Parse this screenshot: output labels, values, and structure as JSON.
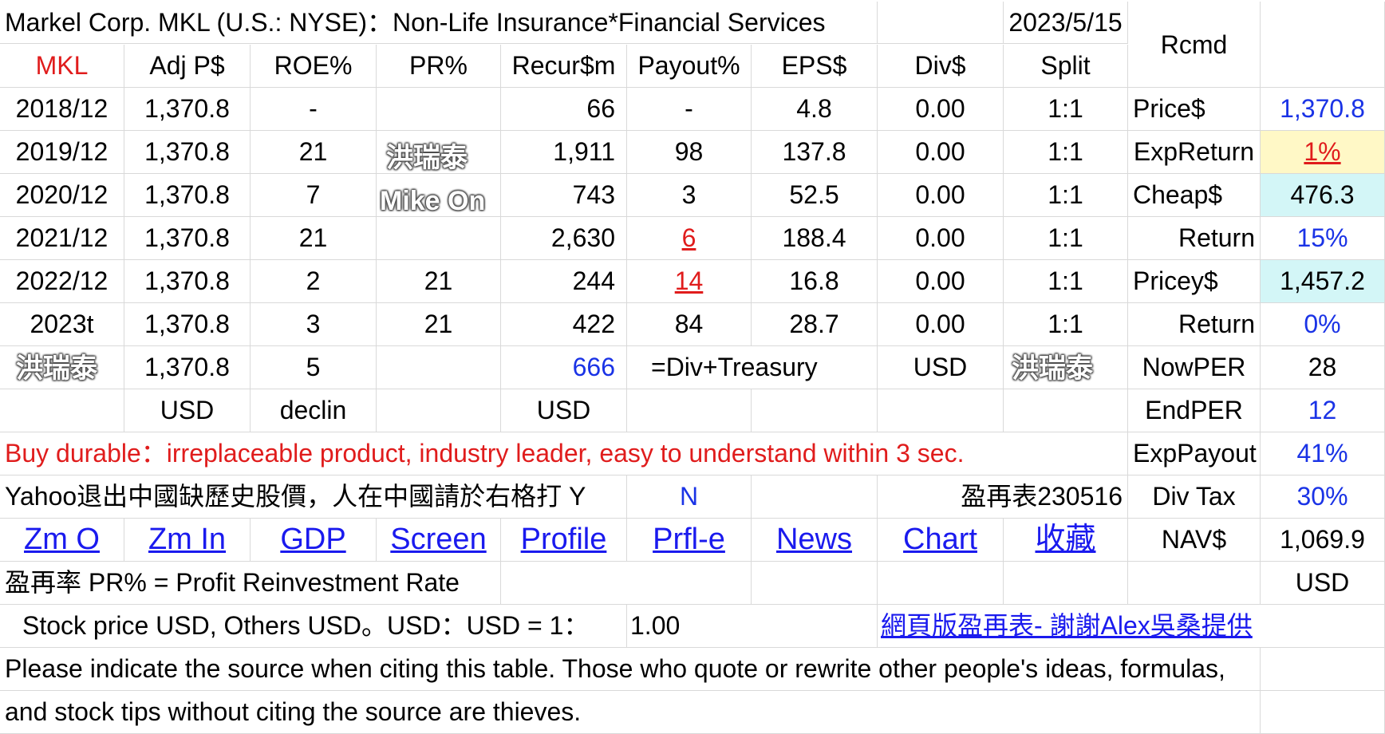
{
  "header": {
    "title": "Markel Corp. MKL (U.S.: NYSE)：Non-Life Insurance*Financial Services",
    "date": "2023/5/15",
    "rcmd": "Rcmd"
  },
  "columns": {
    "ticker": "MKL",
    "adj_price": "Adj P$",
    "roe": "ROE%",
    "pr": "PR%",
    "recur": "Recur$m",
    "payout": "Payout%",
    "eps": "EPS$",
    "div": "Div$",
    "split": "Split"
  },
  "rows": [
    {
      "year": "2018/12",
      "adj": "1,370.8",
      "roe": "-",
      "pr": "",
      "recur": "66",
      "payout": "-",
      "eps": "4.8",
      "div": "0.00",
      "split": "1:1"
    },
    {
      "year": "2019/12",
      "adj": "1,370.8",
      "roe": "21",
      "pr": "",
      "recur": "1,911",
      "payout": "98",
      "eps": "137.8",
      "div": "0.00",
      "split": "1:1"
    },
    {
      "year": "2020/12",
      "adj": "1,370.8",
      "roe": "7",
      "pr": "",
      "recur": "743",
      "payout": "3",
      "eps": "52.5",
      "div": "0.00",
      "split": "1:1"
    },
    {
      "year": "2021/12",
      "adj": "1,370.8",
      "roe": "21",
      "pr": "",
      "recur": "2,630",
      "payout": "6",
      "eps": "188.4",
      "div": "0.00",
      "split": "1:1"
    },
    {
      "year": "2022/12",
      "adj": "1,370.8",
      "roe": "2",
      "pr": "21",
      "recur": "244",
      "payout": "14",
      "eps": "16.8",
      "div": "0.00",
      "split": "1:1"
    },
    {
      "year": "2023t",
      "adj": "1,370.8",
      "roe": "3",
      "pr": "21",
      "recur": "422",
      "payout": "84",
      "eps": "28.7",
      "div": "0.00",
      "split": "1:1"
    }
  ],
  "summary_row": {
    "adj": "1,370.8",
    "roe": "5",
    "recur": "666",
    "formula": "=Div+Treasury",
    "currency": "USD"
  },
  "units_row": {
    "adj": "USD",
    "roe": "declin",
    "recur": "USD"
  },
  "side": [
    {
      "label": "Price$",
      "value": "1,370.8"
    },
    {
      "label": "ExpReturn",
      "value": "1%"
    },
    {
      "label": "Cheap$",
      "value": "476.3"
    },
    {
      "label": "Return",
      "value": "15%"
    },
    {
      "label": "Pricey$",
      "value": "1,457.2"
    },
    {
      "label": "Return",
      "value": "0%"
    },
    {
      "label": "NowPER",
      "value": "28"
    },
    {
      "label": "EndPER",
      "value": "12"
    },
    {
      "label": "ExpPayout",
      "value": "41%"
    },
    {
      "label": "Div Tax",
      "value": "30%"
    },
    {
      "label": "NAV$",
      "value": "1,069.9"
    },
    {
      "label": "",
      "value": "USD"
    }
  ],
  "buy_note": "Buy durable：irreplaceable product, industry leader, easy to understand within 3 sec.",
  "yahoo_note": "Yahoo退出中國缺歷史股價，人在中國請於右格打 Y",
  "yahoo_value": "N",
  "version": "盈再表230516",
  "links": [
    "Zm O",
    "Zm In",
    "GDP",
    "Screen",
    "Profile",
    "Prfl-e",
    "News",
    "Chart",
    "收藏"
  ],
  "pr_definition": "盈再率 PR% = Profit Reinvestment Rate",
  "fx_note": "Stock price USD, Others USD。USD：USD = 1：",
  "fx_value": "1.00",
  "web_link": "網頁版盈再表- 謝謝Alex吳桑提供",
  "citation_line1": "Please indicate the source when citing this table. Those who quote or rewrite other people's ideas, formulas,",
  "citation_line2": "and stock tips without citing the source are thieves.",
  "watermarks": [
    "洪瑞泰",
    "Mike On",
    "洪瑞泰",
    "洪瑞泰"
  ],
  "colors": {
    "link": "#1a1aee",
    "highlight_red": "#e01c1c",
    "value_blue": "#1a33e6",
    "yellow_fill": "#fff8c6",
    "cyan_fill": "#d3f6f7"
  }
}
